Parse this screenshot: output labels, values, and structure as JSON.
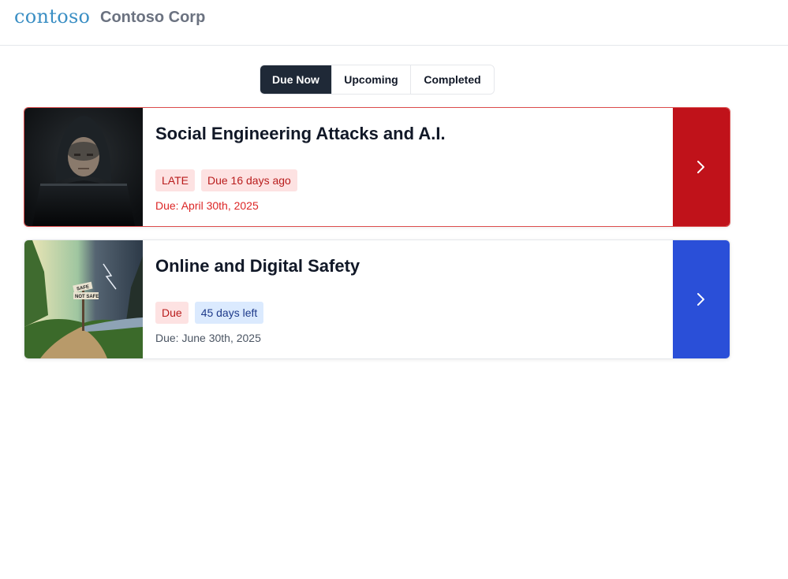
{
  "header": {
    "logo_text": "contoso",
    "company": "Contoso Corp"
  },
  "tabs": [
    {
      "label": "Due Now",
      "active": true
    },
    {
      "label": "Upcoming",
      "active": false
    },
    {
      "label": "Completed",
      "active": false
    }
  ],
  "courses": [
    {
      "title": "Social Engineering Attacks and A.I.",
      "status_badge": "LATE",
      "time_badge": "Due 16 days ago",
      "due": "Due: April 30th, 2025",
      "accent": "#c0121a",
      "thumbnail": "hooded-hacker-at-laptop",
      "open_icon": "chevron-right-icon"
    },
    {
      "title": "Online and Digital Safety",
      "status_badge": "Due",
      "time_badge": "45 days left",
      "due": "Due: June 30th, 2025",
      "accent": "#2a4fd8",
      "thumbnail": "forked-path-safe-not-safe-sign",
      "sign_safe": "SAFE",
      "sign_not_safe": "NOT SAFE",
      "open_icon": "chevron-right-icon"
    }
  ]
}
